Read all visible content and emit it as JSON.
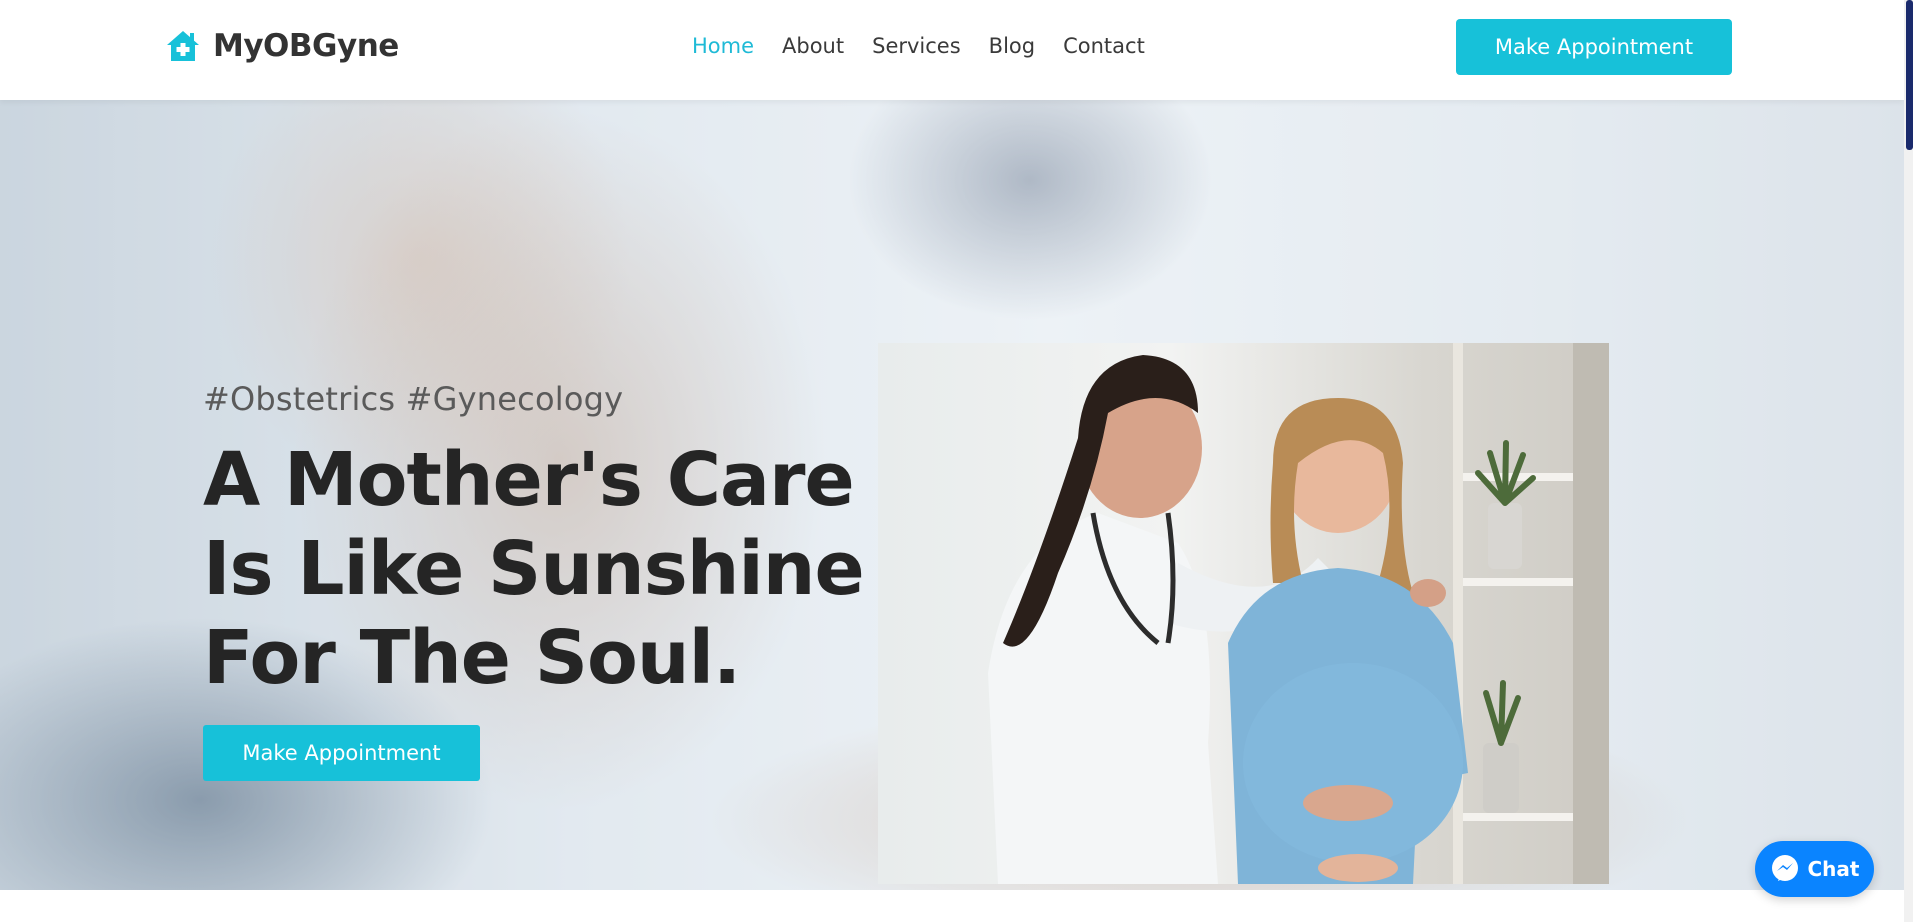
{
  "header": {
    "logo_text": "MyOBGyne",
    "logo_icon": "house-medical-icon",
    "nav": [
      {
        "label": "Home",
        "active": true
      },
      {
        "label": "About",
        "active": false
      },
      {
        "label": "Services",
        "active": false
      },
      {
        "label": "Blog",
        "active": false
      },
      {
        "label": "Contact",
        "active": false
      }
    ],
    "cta_label": "Make Appointment"
  },
  "hero": {
    "tagline": "#Obstetrics #Gynecology",
    "headline_lines": [
      "A Mother's Care",
      "Is Like Sunshine",
      "For The Soul."
    ],
    "cta_label": "Make Appointment",
    "background_image": "ultrasound-exam-photo",
    "feature_image": "doctor-with-pregnant-patient-photo"
  },
  "chat": {
    "label": "Chat",
    "icon": "messenger-icon"
  },
  "colors": {
    "accent": "#17c1d9",
    "nav_active": "#1fbad6",
    "text_dark": "#252525",
    "chat_blue": "#0a84ff",
    "scrollbar": "#1a2a6c"
  }
}
